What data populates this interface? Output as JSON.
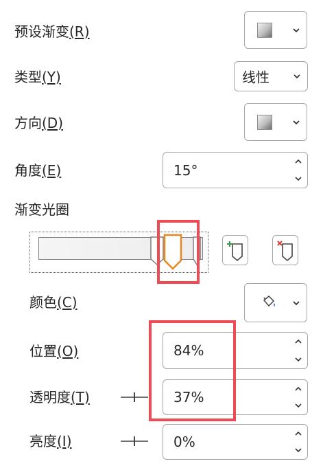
{
  "fields": {
    "preset_gradient": {
      "label": "预设渐变",
      "key": "(R)"
    },
    "type": {
      "label": "类型",
      "key": "(Y)",
      "value": "线性"
    },
    "direction": {
      "label": "方向",
      "key": "(D)"
    },
    "angle": {
      "label": "角度",
      "key": "(E)",
      "value": "15°"
    },
    "gradient_stops": {
      "label": "渐变光圈"
    },
    "color": {
      "label": "颜色",
      "key": "(C)"
    },
    "position": {
      "label": "位置",
      "key": "(O)",
      "value": "84%"
    },
    "transparency": {
      "label": "透明度",
      "key": "(T)",
      "value": "37%"
    },
    "brightness": {
      "label": "亮度",
      "key": "(I)",
      "value": "0%"
    }
  },
  "gradient": {
    "stops_percent": [
      84,
      100
    ],
    "selected_stop_percent": 84
  },
  "colors": {
    "highlight": "#ee4b55",
    "selected_stop": "#e8871e",
    "add_stop_plus": "#2e9e4b",
    "remove_stop_x": "#d63a3a"
  },
  "icons": {
    "dropdown": "chevron-down-icon",
    "spinner_up": "chevron-up-icon",
    "spinner_down": "chevron-down-icon",
    "add_stop": "add-gradient-stop-icon",
    "remove_stop": "remove-gradient-stop-icon",
    "fill_color": "paint-bucket-icon"
  }
}
